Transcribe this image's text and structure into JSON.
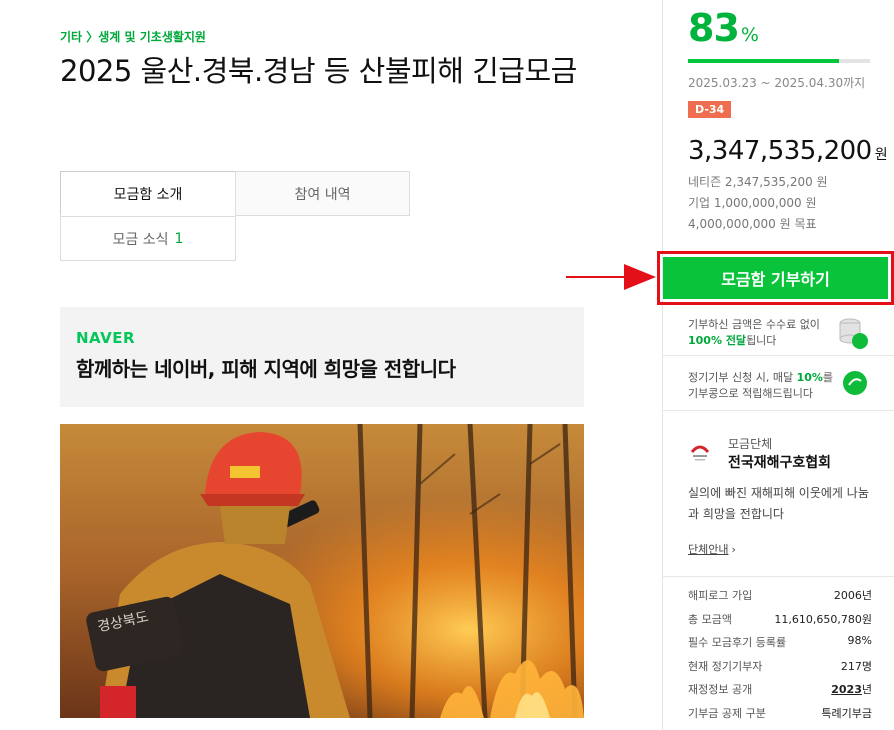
{
  "category": "기타 〉생계 및 기초생활지원",
  "title": "2025 울산.경북.경남 등 산불피해 긴급모금",
  "tabs": {
    "intro": "모금함 소개",
    "participation": "참여 내역",
    "news": "모금 소식",
    "news_count": "1"
  },
  "naver_box": {
    "logo": "NAVER",
    "headline": "함께하는 네이버, 피해 지역에 희망을 전합니다"
  },
  "sidebar": {
    "percent": "83",
    "percent_unit": "%",
    "progress": 0.83,
    "period": "2025.03.23 ~ 2025.04.30까지",
    "dday": "D-34",
    "amount": "3,347,535,200",
    "amount_unit": "원",
    "netizen": "네티즌 2,347,535,200 원",
    "company": "기업 1,000,000,000 원",
    "goal": "4,000,000,000 원 목표",
    "donate_button": "모금함 기부하기",
    "benefit1_line1": "기부하신 금액은 수수료 없이",
    "benefit1_bold": "100% 전달",
    "benefit1_tail": "됩니다",
    "benefit2_head": "정기기부 신청 시, 매달 ",
    "benefit2_bold": "10%",
    "benefit2_tail": "를",
    "benefit2_line2": "기부콩으로 적립해드립니다",
    "org_label": "모금단체",
    "org_name": "전국재해구호협회",
    "org_desc": "실의에 빠진 재해피해 이웃에게 나눔과 희망을 전합니다",
    "org_link": "단체안내",
    "stats": [
      {
        "label": "해피로그 가입",
        "value": "2006년"
      },
      {
        "label": "총 모금액",
        "value": "11,610,650,780원"
      },
      {
        "label": "필수 모금후기 등록률",
        "value": "98%"
      },
      {
        "label": "현재 정기기부자",
        "value": "217명"
      },
      {
        "label": "재정정보 공개",
        "value_year": "2023",
        "value_unit": "년"
      },
      {
        "label": "기부금 공제 구분",
        "value": "특례기부금"
      }
    ]
  },
  "colors": {
    "accent_green": "#00b33c",
    "button_green": "#09c43b",
    "highlight_red": "#e3101a",
    "dday_orange": "#ee6e4f"
  }
}
